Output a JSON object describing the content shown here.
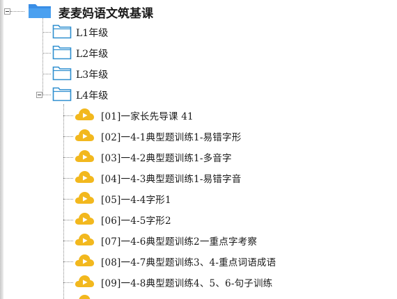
{
  "tree": {
    "root": {
      "label": "麦麦妈语文筑基课",
      "icon": "folder-icon",
      "expanded": true
    },
    "levels": [
      {
        "label": "L1年级",
        "icon": "folder-outline-icon",
        "expanded": false
      },
      {
        "label": "L2年级",
        "icon": "folder-outline-icon",
        "expanded": false
      },
      {
        "label": "L3年级",
        "icon": "folder-outline-icon",
        "expanded": false
      },
      {
        "label": "L4年级",
        "icon": "folder-outline-icon",
        "expanded": true
      }
    ],
    "files": [
      {
        "label": "[01]一家长先导课  41",
        "icon": "video-cloud-icon"
      },
      {
        "label": "[02]一4-1典型题训练1-易错字形",
        "icon": "video-cloud-icon"
      },
      {
        "label": "[03]一4-2典型题训练1-多音字",
        "icon": "video-cloud-icon"
      },
      {
        "label": "[04]一4-3典型题训练1-易错字音",
        "icon": "video-cloud-icon"
      },
      {
        "label": "[05]一4-4字形1",
        "icon": "video-cloud-icon"
      },
      {
        "label": "[06]一4-5字形2",
        "icon": "video-cloud-icon"
      },
      {
        "label": "[07]一4-6典型题训练2一重点字考察",
        "icon": "video-cloud-icon"
      },
      {
        "label": "[08]一4-7典型题训练3、4-重点词语成语",
        "icon": "video-cloud-icon"
      },
      {
        "label": "[09]一4-8典型题训练4、5、6-句子训练",
        "icon": "video-cloud-icon"
      }
    ],
    "colors": {
      "folder_blue": "#3a8ee6",
      "folder_outline": "#2f8fd0",
      "cloud_yellow": "#f2b81e",
      "connector": "#8a8a8a"
    }
  }
}
